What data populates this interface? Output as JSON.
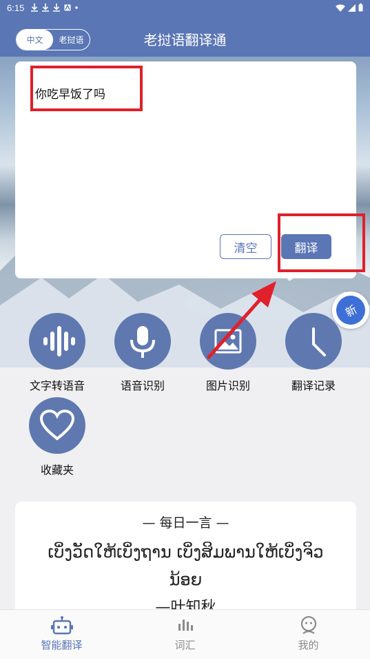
{
  "status_bar": {
    "time": "6:15"
  },
  "header": {
    "title": "老挝语翻译通",
    "lang_toggle": {
      "option_a": "中文",
      "option_b": "老挝语"
    }
  },
  "input": {
    "text": "你吃早饭了吗"
  },
  "buttons": {
    "clear": "清空",
    "translate": "翻译"
  },
  "float_badge": {
    "label": "新"
  },
  "features": [
    {
      "label": "文字转语音",
      "icon": "waveform-icon"
    },
    {
      "label": "语音识别",
      "icon": "microphone-icon"
    },
    {
      "label": "图片识别",
      "icon": "image-icon"
    },
    {
      "label": "翻译记录",
      "icon": "clock-icon"
    },
    {
      "label": "收藏夹",
      "icon": "heart-icon"
    }
  ],
  "daily_quote": {
    "title": "— 每日一言 —",
    "text": "ເບິ່ງວັດໃຫ້ເບິ່ງຖານ ເບິ່ງສິມພານໃຫ້ເບິ່ງຈິວນ້ອຍ",
    "author": "—叶知秋"
  },
  "tabs": [
    {
      "label": "智能翻译",
      "icon": "robot-icon",
      "active": true
    },
    {
      "label": "词汇",
      "icon": "bars-icon",
      "active": false
    },
    {
      "label": "我的",
      "icon": "user-face-icon",
      "active": false
    }
  ],
  "colors": {
    "primary": "#5a76b5",
    "highlight": "#e0202a",
    "feature_circle": "#5f78b0"
  }
}
